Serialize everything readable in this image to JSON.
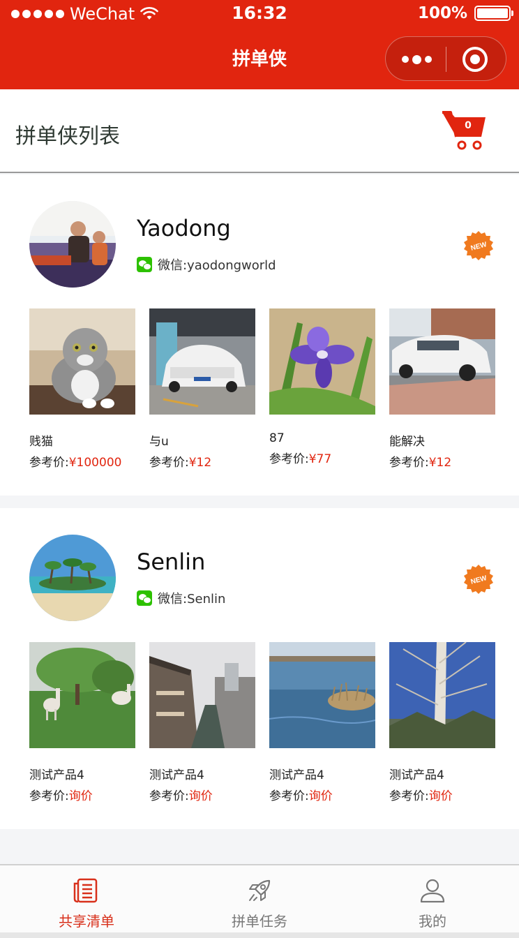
{
  "status_bar": {
    "carrier": "WeChat",
    "time": "16:32",
    "battery": "100%"
  },
  "nav": {
    "title": "拼单侠"
  },
  "page": {
    "title": "拼单侠列表",
    "cart_count": "0"
  },
  "sellers": [
    {
      "name": "Yaodong",
      "wechat": "微信:yaodongworld",
      "badge": "NEW",
      "products": [
        {
          "name": "贱猫",
          "price_label": "参考价:",
          "price": "¥100000"
        },
        {
          "name": "与u",
          "price_label": "参考价:",
          "price": "¥12"
        },
        {
          "name": "87",
          "price_label": "参考价:",
          "price": "¥77"
        },
        {
          "name": "能解决",
          "price_label": "参考价:",
          "price": "¥12"
        }
      ]
    },
    {
      "name": "Senlin",
      "wechat": "微信:Senlin",
      "badge": "NEW",
      "products": [
        {
          "name": "测试产品4",
          "price_label": "参考价:",
          "price": "询价"
        },
        {
          "name": "测试产品4",
          "price_label": "参考价:",
          "price": "询价"
        },
        {
          "name": "测试产品4",
          "price_label": "参考价:",
          "price": "询价"
        },
        {
          "name": "测试产品4",
          "price_label": "参考价:",
          "price": "询价"
        }
      ]
    }
  ],
  "tabbar": {
    "items": [
      {
        "label": "共享清单",
        "icon": "list-icon",
        "active": true
      },
      {
        "label": "拼单任务",
        "icon": "rocket-icon",
        "active": false
      },
      {
        "label": "我的",
        "icon": "user-icon",
        "active": false
      }
    ]
  },
  "colors": {
    "brand_red": "#e1250f",
    "price_red": "#e1250f",
    "wechat_green": "#2dc100",
    "badge_orange": "#f07a1f"
  }
}
